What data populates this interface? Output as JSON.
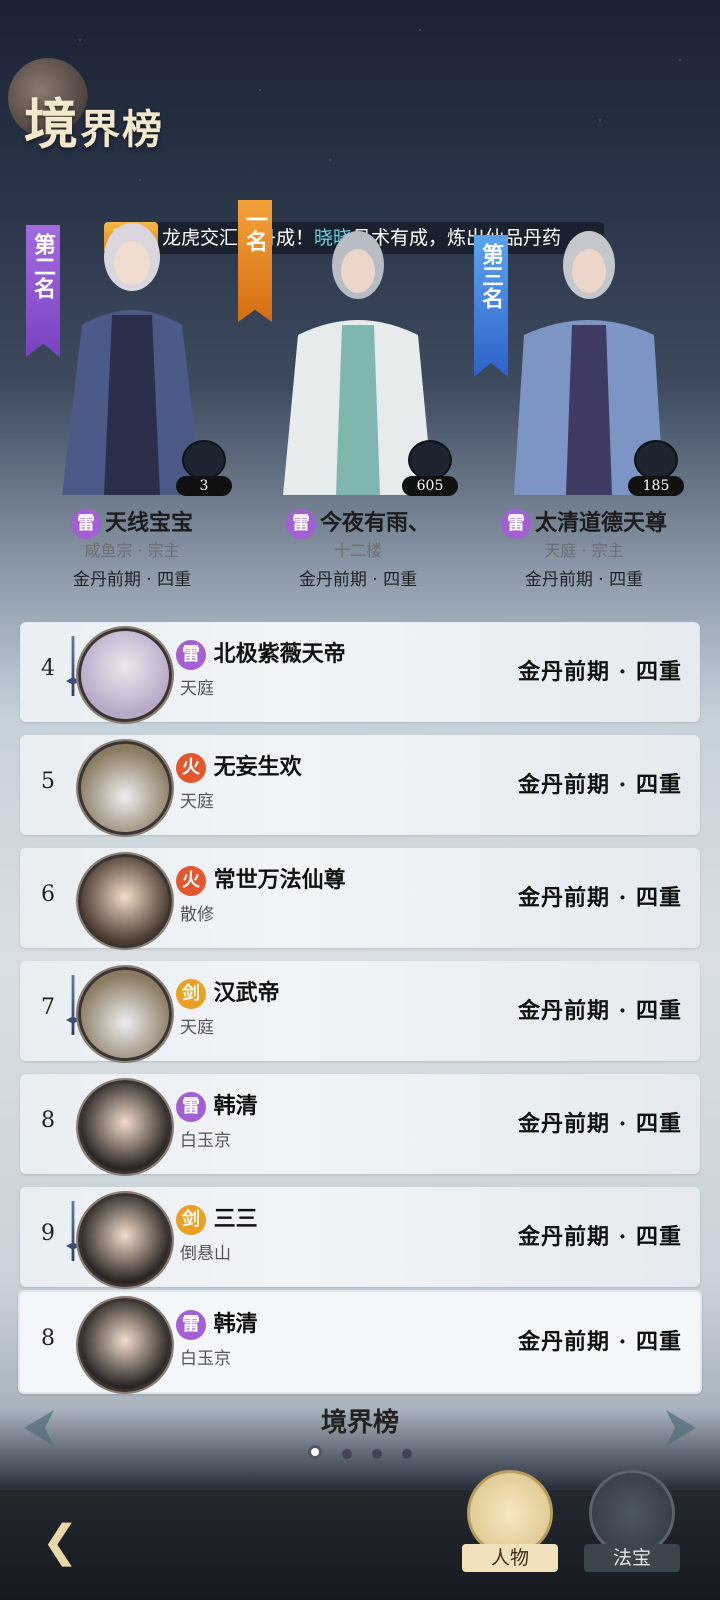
{
  "header": {
    "title_big": "境",
    "title_rest": "界榜"
  },
  "ticker": {
    "tag": "天眷",
    "text_a": "龙虎交汇金丹成！",
    "highlight": "晓晓",
    "text_b": "丹术有成，炼出仙品丹药"
  },
  "podium": [
    {
      "place_label": "第二名",
      "element": "雷",
      "name": "天线宝宝",
      "sect": "咸鱼宗 · 宗主",
      "realm": "金丹前期 · 四重",
      "badge_count": "3"
    },
    {
      "place_label": "一名",
      "element": "雷",
      "name": "今夜有雨、",
      "sect": "十二楼",
      "realm": "金丹前期 · 四重",
      "badge_count": "605"
    },
    {
      "place_label": "第三名",
      "element": "雷",
      "name": "太清道德天尊",
      "sect": "天庭 · 宗主",
      "realm": "金丹前期 · 四重",
      "badge_count": "185"
    }
  ],
  "rows": [
    {
      "rank": "4",
      "element": "雷",
      "name": "北极紫薇天帝",
      "sect": "天庭",
      "realm": "金丹前期 · 四重"
    },
    {
      "rank": "5",
      "element": "火",
      "name": "无妄生欢",
      "sect": "天庭",
      "realm": "金丹前期 · 四重"
    },
    {
      "rank": "6",
      "element": "火",
      "name": "常世万法仙尊",
      "sect": "散修",
      "realm": "金丹前期 · 四重"
    },
    {
      "rank": "7",
      "element": "剑",
      "name": "汉武帝",
      "sect": "天庭",
      "realm": "金丹前期 · 四重"
    },
    {
      "rank": "8",
      "element": "雷",
      "name": "韩清",
      "sect": "白玉京",
      "realm": "金丹前期 · 四重"
    },
    {
      "rank": "9",
      "element": "剑",
      "name": "三三",
      "sect": "倒悬山",
      "realm": "金丹前期 · 四重"
    }
  ],
  "mine": {
    "rank": "8",
    "element": "雷",
    "name": "韩清",
    "sect": "白玉京",
    "realm": "金丹前期 · 四重"
  },
  "pager": {
    "title": "境界榜",
    "pages": 4,
    "active": 0
  },
  "tabs": {
    "person": "人物",
    "treasure": "法宝"
  },
  "colors": {
    "thunder": "#a45fd4",
    "fire": "#e3572f",
    "sword": "#eca021"
  }
}
